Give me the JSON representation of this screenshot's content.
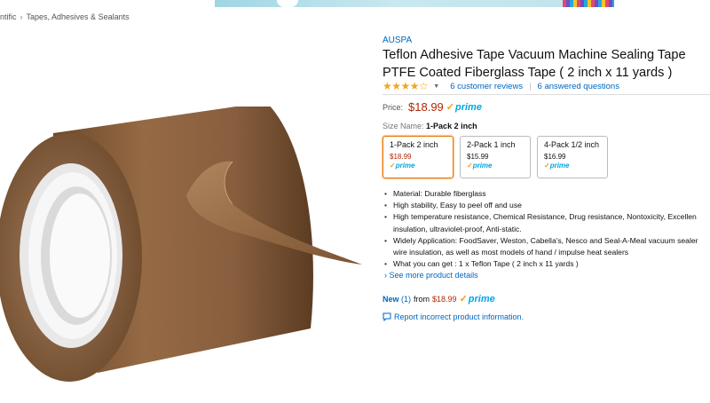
{
  "breadcrumb": [
    "ntific",
    "Tapes, Adhesives & Sealants"
  ],
  "product": {
    "brand": "AUSPA",
    "title": "Teflon Adhesive Tape Vacuum Machine Sealing Tape PTFE Coated Fiberglass Tape ( 2 inch x 11 yards )",
    "rating": 4.5,
    "stars_display": "★★★★☆",
    "reviews_link": "6 customer reviews",
    "questions_link": "6 answered questions",
    "price_label": "Price:",
    "price": "$18.99",
    "prime_label": "prime",
    "size_label": "Size Name:",
    "size_value": "1-Pack 2 inch"
  },
  "size_options": [
    {
      "name": "1-Pack 2 inch",
      "price": "$18.99",
      "prime": "prime",
      "selected": true
    },
    {
      "name": "2-Pack 1 inch",
      "price": "$15.99",
      "prime": "prime",
      "selected": false
    },
    {
      "name": "4-Pack 1/2 inch",
      "price": "$16.99",
      "prime": "prime",
      "selected": false
    }
  ],
  "features": [
    [
      "Material: Durable fiberglass"
    ],
    [
      "High stability, Easy to peel off and use"
    ],
    [
      "High temperature resistance, Chemical Resistance, Drug resistance, Nontoxicity, Excellen",
      "insulation, ultraviolet-proof, Anti-static."
    ],
    [
      "Widely Application: FoodSaver, Weston, Cabella's, Nesco and Seal-A-Meal vacuum sealer",
      "wire insulation, as well as most models of hand / impulse heat sealers"
    ],
    [
      "What you can get : 1 x Teflon Tape ( 2 inch x 11 yards )"
    ]
  ],
  "more_details": "See more product details",
  "new_offers": {
    "label": "New",
    "count": "(1)",
    "from": "from",
    "price": "$18.99",
    "prime": "prime"
  },
  "report": "Report incorrect product information.",
  "colors": {
    "link": "#0066c0",
    "price": "#b12704",
    "prime": "#00a8e1",
    "star": "#f0a71a",
    "selected_border": "#e77600"
  }
}
